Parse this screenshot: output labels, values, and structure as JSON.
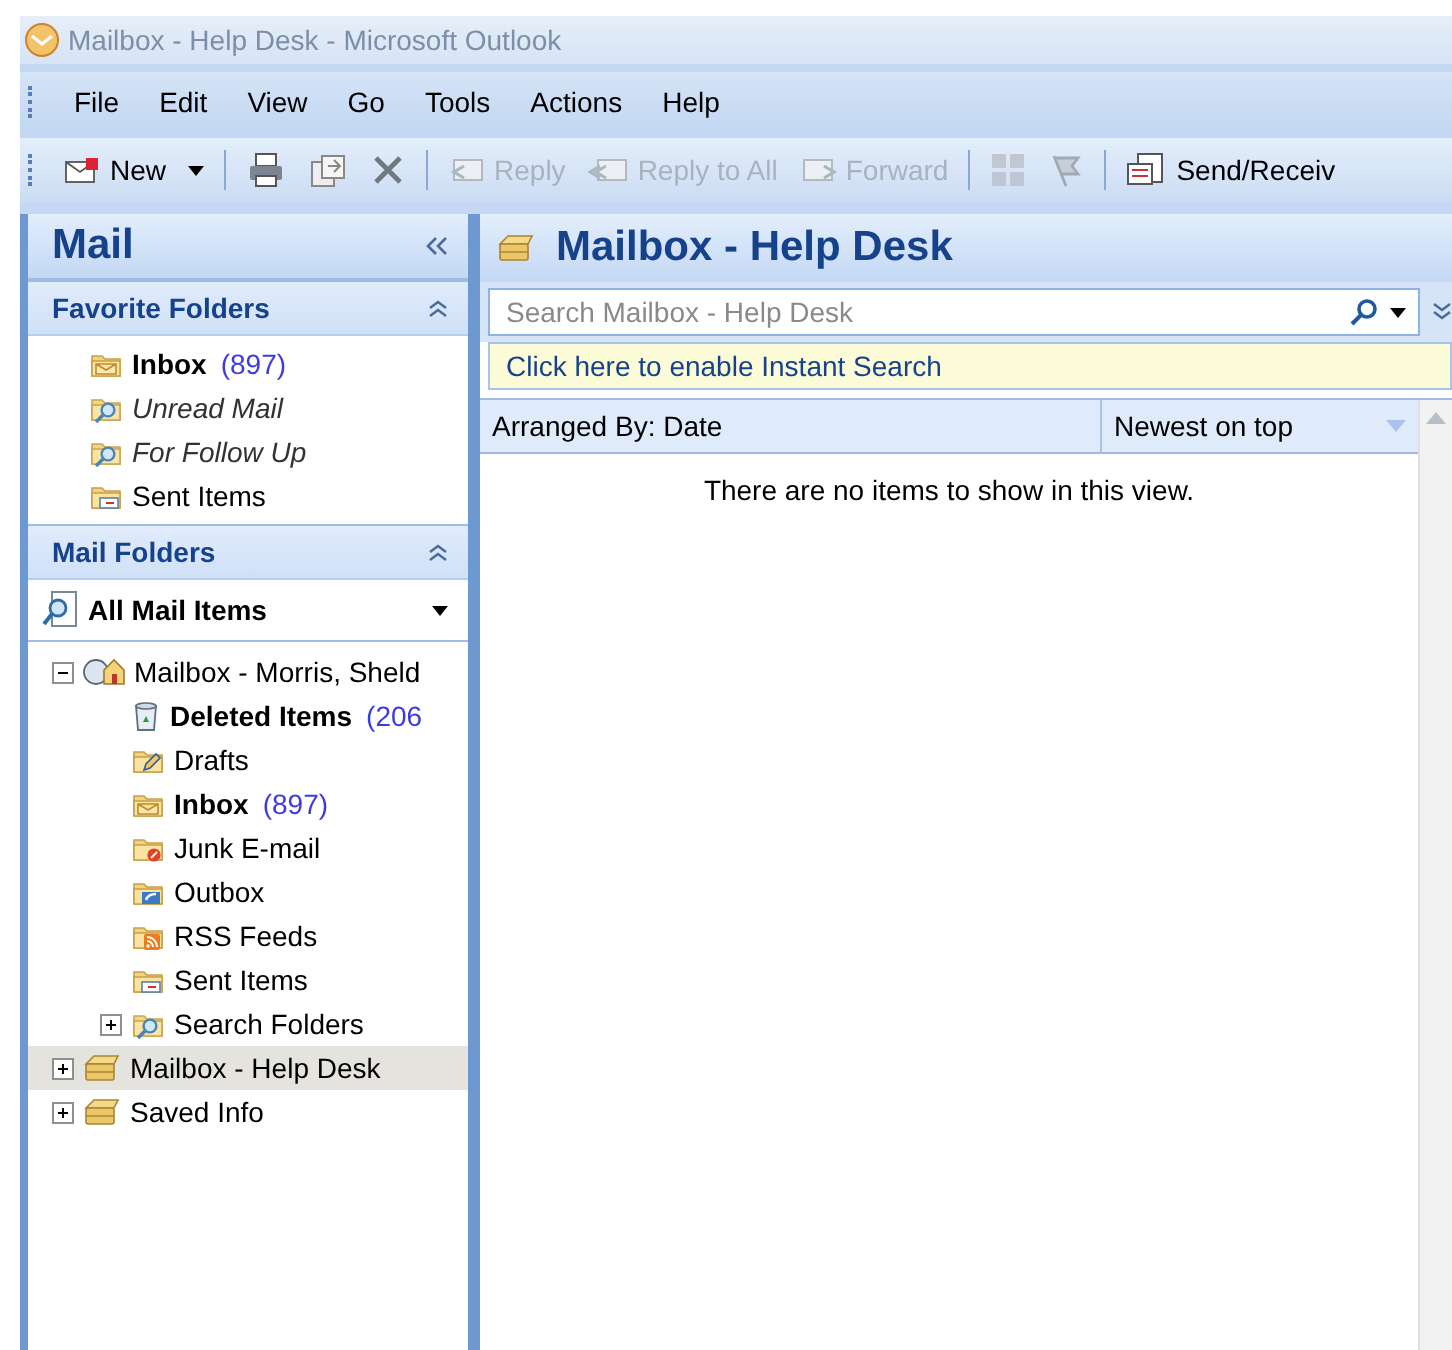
{
  "window": {
    "title": "Mailbox - Help Desk - Microsoft Outlook"
  },
  "menu": [
    {
      "label": "File"
    },
    {
      "label": "Edit"
    },
    {
      "label": "View"
    },
    {
      "label": "Go"
    },
    {
      "label": "Tools"
    },
    {
      "label": "Actions"
    },
    {
      "label": "Help"
    }
  ],
  "toolbar": [
    {
      "kind": "new",
      "label": "New",
      "disabled": false
    },
    {
      "kind": "separator"
    },
    {
      "kind": "print",
      "disabled": false
    },
    {
      "kind": "move",
      "disabled": false
    },
    {
      "kind": "delete",
      "disabled": false
    },
    {
      "kind": "separator"
    },
    {
      "kind": "reply",
      "label": "Reply",
      "disabled": true
    },
    {
      "kind": "replyall",
      "label": "Reply to All",
      "disabled": true
    },
    {
      "kind": "forward",
      "label": "Forward",
      "disabled": true
    },
    {
      "kind": "separator"
    },
    {
      "kind": "categories",
      "disabled": true
    },
    {
      "kind": "flag",
      "disabled": true
    },
    {
      "kind": "separator"
    },
    {
      "kind": "sendreceive",
      "label": "Send/Receiv",
      "disabled": false
    }
  ],
  "nav": {
    "title": "Mail",
    "favorites": {
      "title": "Favorite Folders",
      "items": [
        {
          "kind": "inbox",
          "label": "Inbox",
          "count": "(897)",
          "unread": true
        },
        {
          "kind": "search",
          "label": "Unread Mail",
          "unread": false
        },
        {
          "kind": "search",
          "label": "For Follow Up",
          "unread": false
        },
        {
          "kind": "sent",
          "label": "Sent Items",
          "unread": false
        }
      ]
    },
    "folders": {
      "title": "Mail Folders",
      "view": "All Mail Items",
      "tree": [
        {
          "kind": "home",
          "label": "Mailbox - Morris, Sheld",
          "unread": false,
          "expanded": true,
          "selected": false,
          "children": [
            {
              "kind": "deleted",
              "label": "Deleted Items",
              "count": "(206",
              "unread": true,
              "selected": false
            },
            {
              "kind": "drafts",
              "label": "Drafts",
              "unread": false,
              "selected": false
            },
            {
              "kind": "inbox",
              "label": "Inbox",
              "count": "(897)",
              "unread": true,
              "selected": false
            },
            {
              "kind": "junk",
              "label": "Junk E-mail",
              "unread": false,
              "selected": false
            },
            {
              "kind": "outbox",
              "label": "Outbox",
              "unread": false,
              "selected": false
            },
            {
              "kind": "rss",
              "label": "RSS Feeds",
              "unread": false,
              "selected": false
            },
            {
              "kind": "sent",
              "label": "Sent Items",
              "unread": false,
              "selected": false
            },
            {
              "kind": "search",
              "label": "Search Folders",
              "unread": false,
              "expanded": false,
              "selected": false
            }
          ]
        },
        {
          "kind": "store",
          "label": "Mailbox - Help Desk",
          "unread": false,
          "expanded": false,
          "selected": true
        },
        {
          "kind": "store",
          "label": "Saved Info",
          "unread": false,
          "expanded": false,
          "selected": false
        }
      ]
    }
  },
  "content": {
    "title": "Mailbox - Help Desk",
    "search": {
      "placeholder": "Search Mailbox - Help Desk"
    },
    "info_bar": "Click here to enable Instant Search",
    "arrange": {
      "by": "Arranged By: Date",
      "order": "Newest on top"
    },
    "empty_message": "There are no items to show in this view."
  }
}
